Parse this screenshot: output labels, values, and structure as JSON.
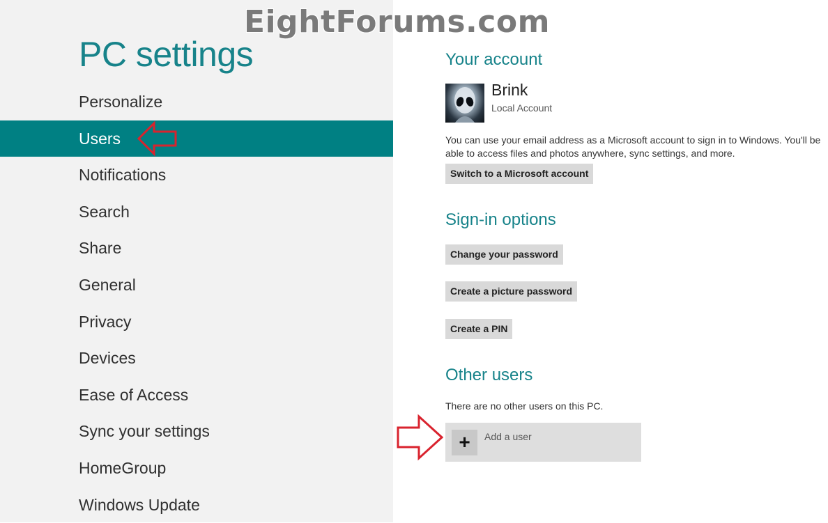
{
  "watermark": "EightForums.com",
  "sidebar": {
    "title": "PC settings",
    "items": [
      {
        "label": "Personalize"
      },
      {
        "label": "Users"
      },
      {
        "label": "Notifications"
      },
      {
        "label": "Search"
      },
      {
        "label": "Share"
      },
      {
        "label": "General"
      },
      {
        "label": "Privacy"
      },
      {
        "label": "Devices"
      },
      {
        "label": "Ease of Access"
      },
      {
        "label": "Sync your settings"
      },
      {
        "label": "HomeGroup"
      },
      {
        "label": "Windows Update"
      }
    ],
    "active_item": "Users"
  },
  "account": {
    "heading": "Your account",
    "user_name": "Brink",
    "account_type": "Local Account",
    "description": "You can use your email address as a Microsoft account to sign in to Windows. You'll be able to access files and photos anywhere, sync settings, and more.",
    "switch_button": "Switch to a Microsoft account"
  },
  "signin": {
    "heading": "Sign-in options",
    "change_password": "Change your password",
    "picture_password": "Create a picture password",
    "create_pin": "Create a PIN"
  },
  "other_users": {
    "heading": "Other users",
    "empty_text": "There are no other users on this PC.",
    "add_user_label": "Add a user",
    "plus_symbol": "+"
  },
  "colors": {
    "accent": "#17838a",
    "active_bg": "#008083",
    "annotation_arrow": "#d9232e"
  }
}
